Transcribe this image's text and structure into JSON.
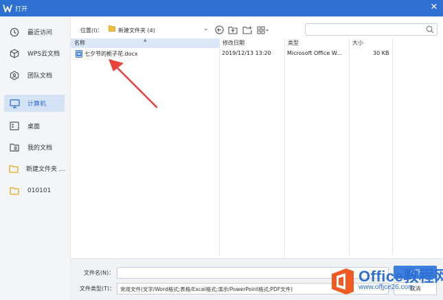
{
  "window": {
    "title": "打开"
  },
  "sidebar": {
    "items": [
      {
        "label": "最近访问",
        "icon": "clock-icon",
        "active": false
      },
      {
        "label": "WPS云文档",
        "icon": "cube-icon",
        "active": false
      },
      {
        "label": "团队文档",
        "icon": "team-icon",
        "active": false
      },
      {
        "label": "计算机",
        "icon": "monitor-icon",
        "active": true
      },
      {
        "label": "桌面",
        "icon": "desktop-icon",
        "active": false
      },
      {
        "label": "我的文档",
        "icon": "my-documents-icon",
        "active": false
      },
      {
        "label": "新建文件夹 ...",
        "icon": "folder-icon",
        "active": false
      },
      {
        "label": "010101",
        "icon": "folder-icon",
        "active": false
      }
    ]
  },
  "toolbar": {
    "location_label": "位置(I)：",
    "location_value": "新建文件夹 (4)",
    "search_placeholder": ""
  },
  "filelist": {
    "columns": [
      "名称",
      "修改日期",
      "类型",
      "大小"
    ],
    "rows": [
      {
        "name": "七夕节的栀子花.docx",
        "modified": "2019/12/13 13:20",
        "type": "Microsoft Office W...",
        "size": "30 KB"
      }
    ]
  },
  "bottom": {
    "filename_label": "文件名(N)：",
    "filename_value": "",
    "filetype_label": "文件类型(T)：",
    "filetype_value": "常用文件(文字/Word格式;表格/Excel格式;演示/PowerPoint格式;PDF文件)",
    "open_label": "打开",
    "cancel_label": "取消"
  },
  "watermark": {
    "line1": "Office教程网",
    "line2": "www.office26.com"
  },
  "colors": {
    "titlebar": "#2e6fd2",
    "sidebar_bg": "#f3f5f8",
    "active_item": "#d4e2f6",
    "arrow": "#e8423b",
    "watermark_orange": "#f15a22"
  }
}
